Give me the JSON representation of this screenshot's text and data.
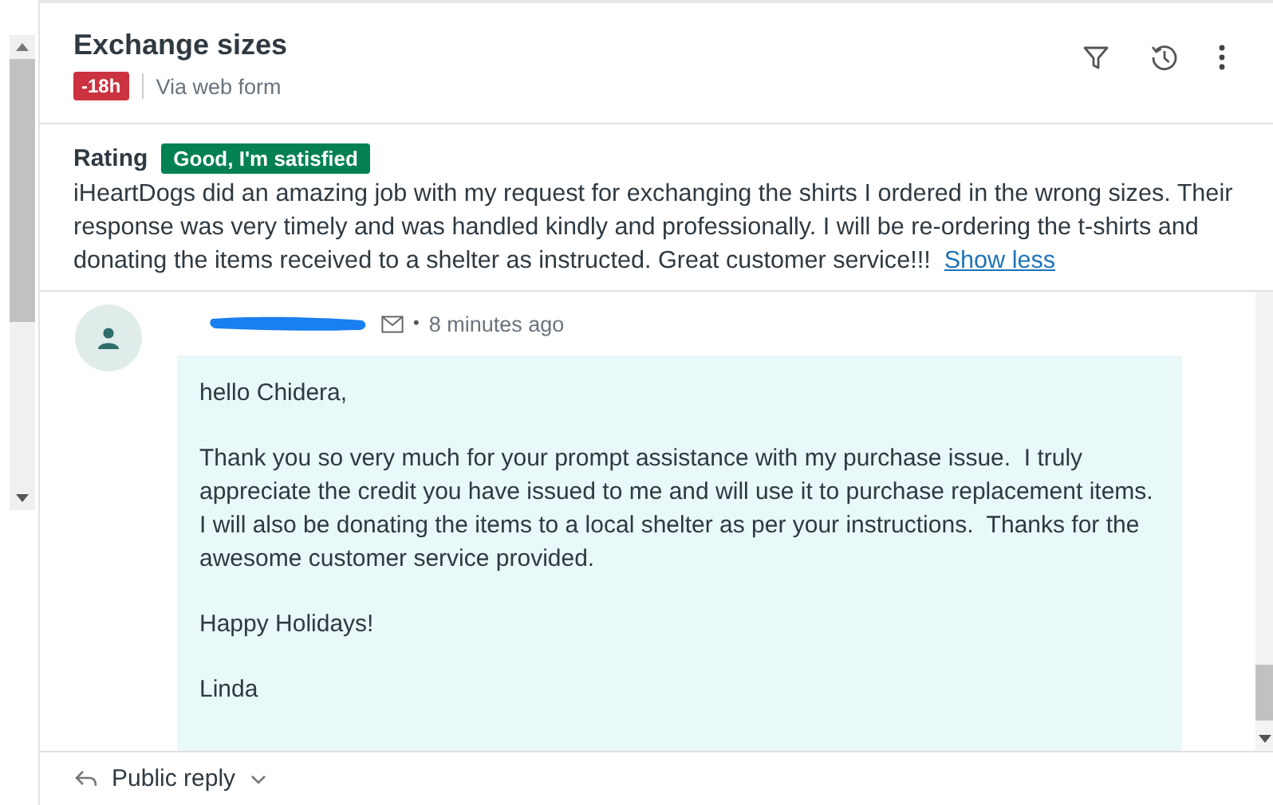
{
  "ticket": {
    "title": "Exchange sizes",
    "age_badge": "-18h",
    "channel": "Via web form"
  },
  "rating": {
    "label": "Rating",
    "value": "Good, I'm satisfied",
    "comment": "iHeartDogs did an amazing job with my request for exchanging the shirts I ordered in the wrong sizes. Their response was very timely and was handled kindly and professionally. I will be re-ordering the t-shirts and donating the items received to a shelter as instructed. Great customer service!!!",
    "toggle_link": "Show less"
  },
  "message": {
    "separator": "•",
    "time": "8 minutes ago",
    "paragraphs": [
      "hello Chidera,",
      "Thank you so very much for your prompt assistance with my purchase issue.  I truly appreciate the credit you have issued to me and will use it to purchase replacement items.  I will also be donating the items to a local shelter as per your instructions.  Thanks for the awesome customer service provided.",
      "Happy Holidays!",
      "Linda"
    ]
  },
  "composer": {
    "mode": "Public reply"
  }
}
